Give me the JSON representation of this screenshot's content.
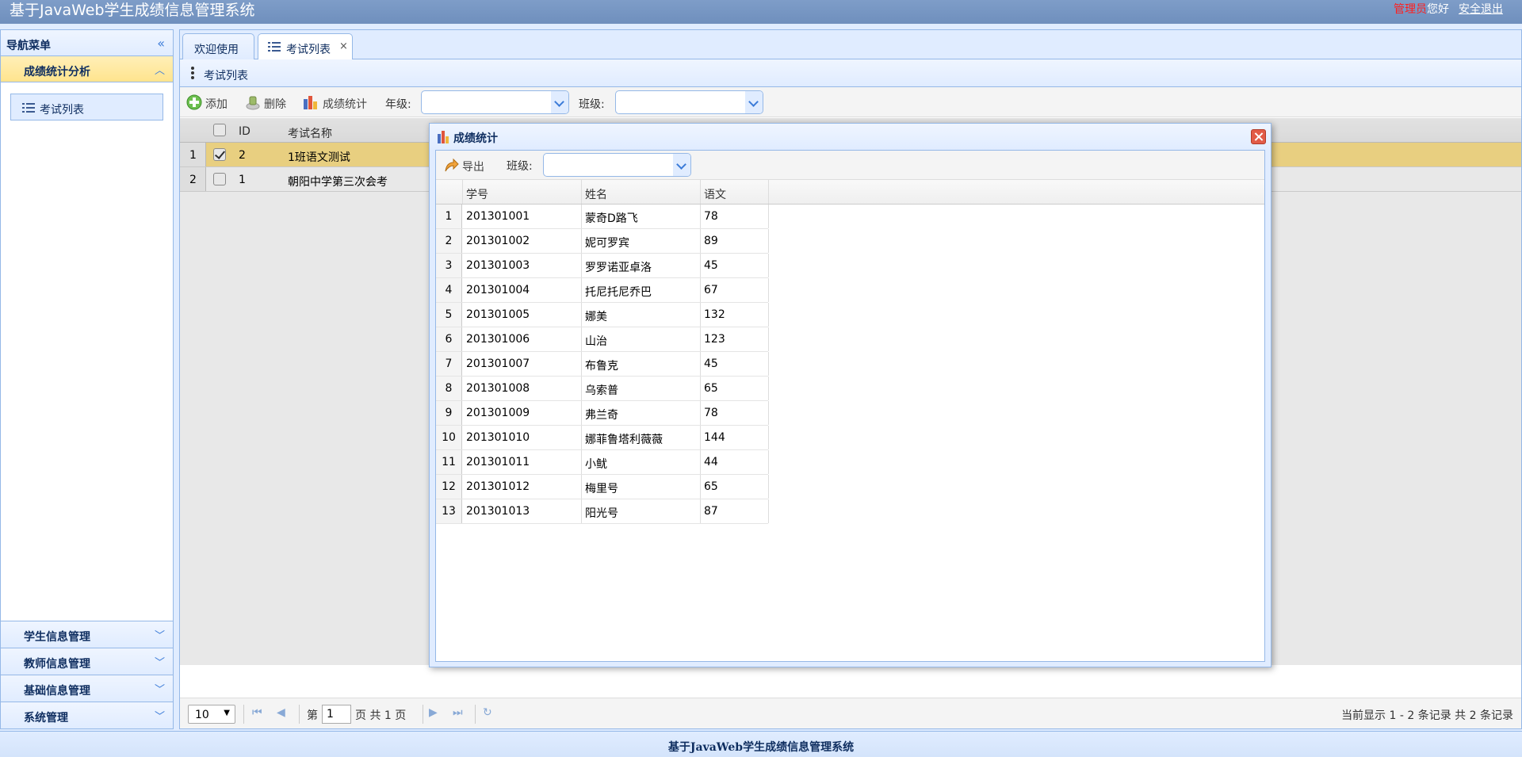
{
  "app": {
    "title": "基于JavaWeb学生成绩信息管理系统",
    "user_role": "管理员",
    "greeting": "您好",
    "logout": "安全退出"
  },
  "sidebar": {
    "title": "导航菜单",
    "sections": [
      {
        "label": "成绩统计分析",
        "expanded": true,
        "items": [
          {
            "label": "考试列表",
            "icon": "list-icon"
          }
        ]
      },
      {
        "label": "学生信息管理",
        "expanded": false
      },
      {
        "label": "教师信息管理",
        "expanded": false
      },
      {
        "label": "基础信息管理",
        "expanded": false
      },
      {
        "label": "系统管理",
        "expanded": false
      }
    ]
  },
  "tabs": [
    {
      "label": "欢迎使用",
      "selected": false
    },
    {
      "label": "考试列表",
      "selected": true,
      "closable": true,
      "close_glyph": "×"
    }
  ],
  "panel": {
    "title": "考试列表"
  },
  "toolbar": {
    "add": "添加",
    "delete": "删除",
    "stats": "成绩统计",
    "grade_label": "年级:",
    "class_label": "班级:",
    "grade_value": "",
    "class_value": ""
  },
  "exam_grid": {
    "columns": [
      "ID",
      "考试名称"
    ],
    "rows": [
      {
        "row_num": "1",
        "checked": true,
        "id": "2",
        "name": "1班语文测试",
        "selected": true
      },
      {
        "row_num": "2",
        "checked": false,
        "id": "1",
        "name": "朝阳中学第三次会考",
        "selected": false
      }
    ]
  },
  "pager": {
    "page_size": "10",
    "page_prefix": "第",
    "page": "1",
    "page_suffix": "页 共 1 页",
    "info": "当前显示 1 - 2 条记录 共 2 条记录"
  },
  "dialog": {
    "title": "成绩统计",
    "export": "导出",
    "class_label": "班级:",
    "class_value": "",
    "columns": [
      "学号",
      "姓名",
      "语文"
    ],
    "rows": [
      [
        "201301001",
        "蒙奇D路飞",
        "78"
      ],
      [
        "201301002",
        "妮可罗宾",
        "89"
      ],
      [
        "201301003",
        "罗罗诺亚卓洛",
        "45"
      ],
      [
        "201301004",
        "托尼托尼乔巴",
        "67"
      ],
      [
        "201301005",
        "娜美",
        "132"
      ],
      [
        "201301006",
        "山治",
        "123"
      ],
      [
        "201301007",
        "布鲁克",
        "45"
      ],
      [
        "201301008",
        "乌索普",
        "65"
      ],
      [
        "201301009",
        "弗兰奇",
        "78"
      ],
      [
        "201301010",
        "娜菲鲁塔利薇薇",
        "144"
      ],
      [
        "201301011",
        "小鱿",
        "44"
      ],
      [
        "201301012",
        "梅里号",
        "65"
      ],
      [
        "201301013",
        "阳光号",
        "87"
      ]
    ]
  },
  "footer": {
    "text": "基于JavaWeb学生成绩信息管理系统"
  },
  "colors": {
    "header": "#7e9dc8",
    "accent": "#95b8e7",
    "selected_row": "#ffe48d",
    "close_button": "#e25b47",
    "role_text": "#ff1e1e"
  }
}
